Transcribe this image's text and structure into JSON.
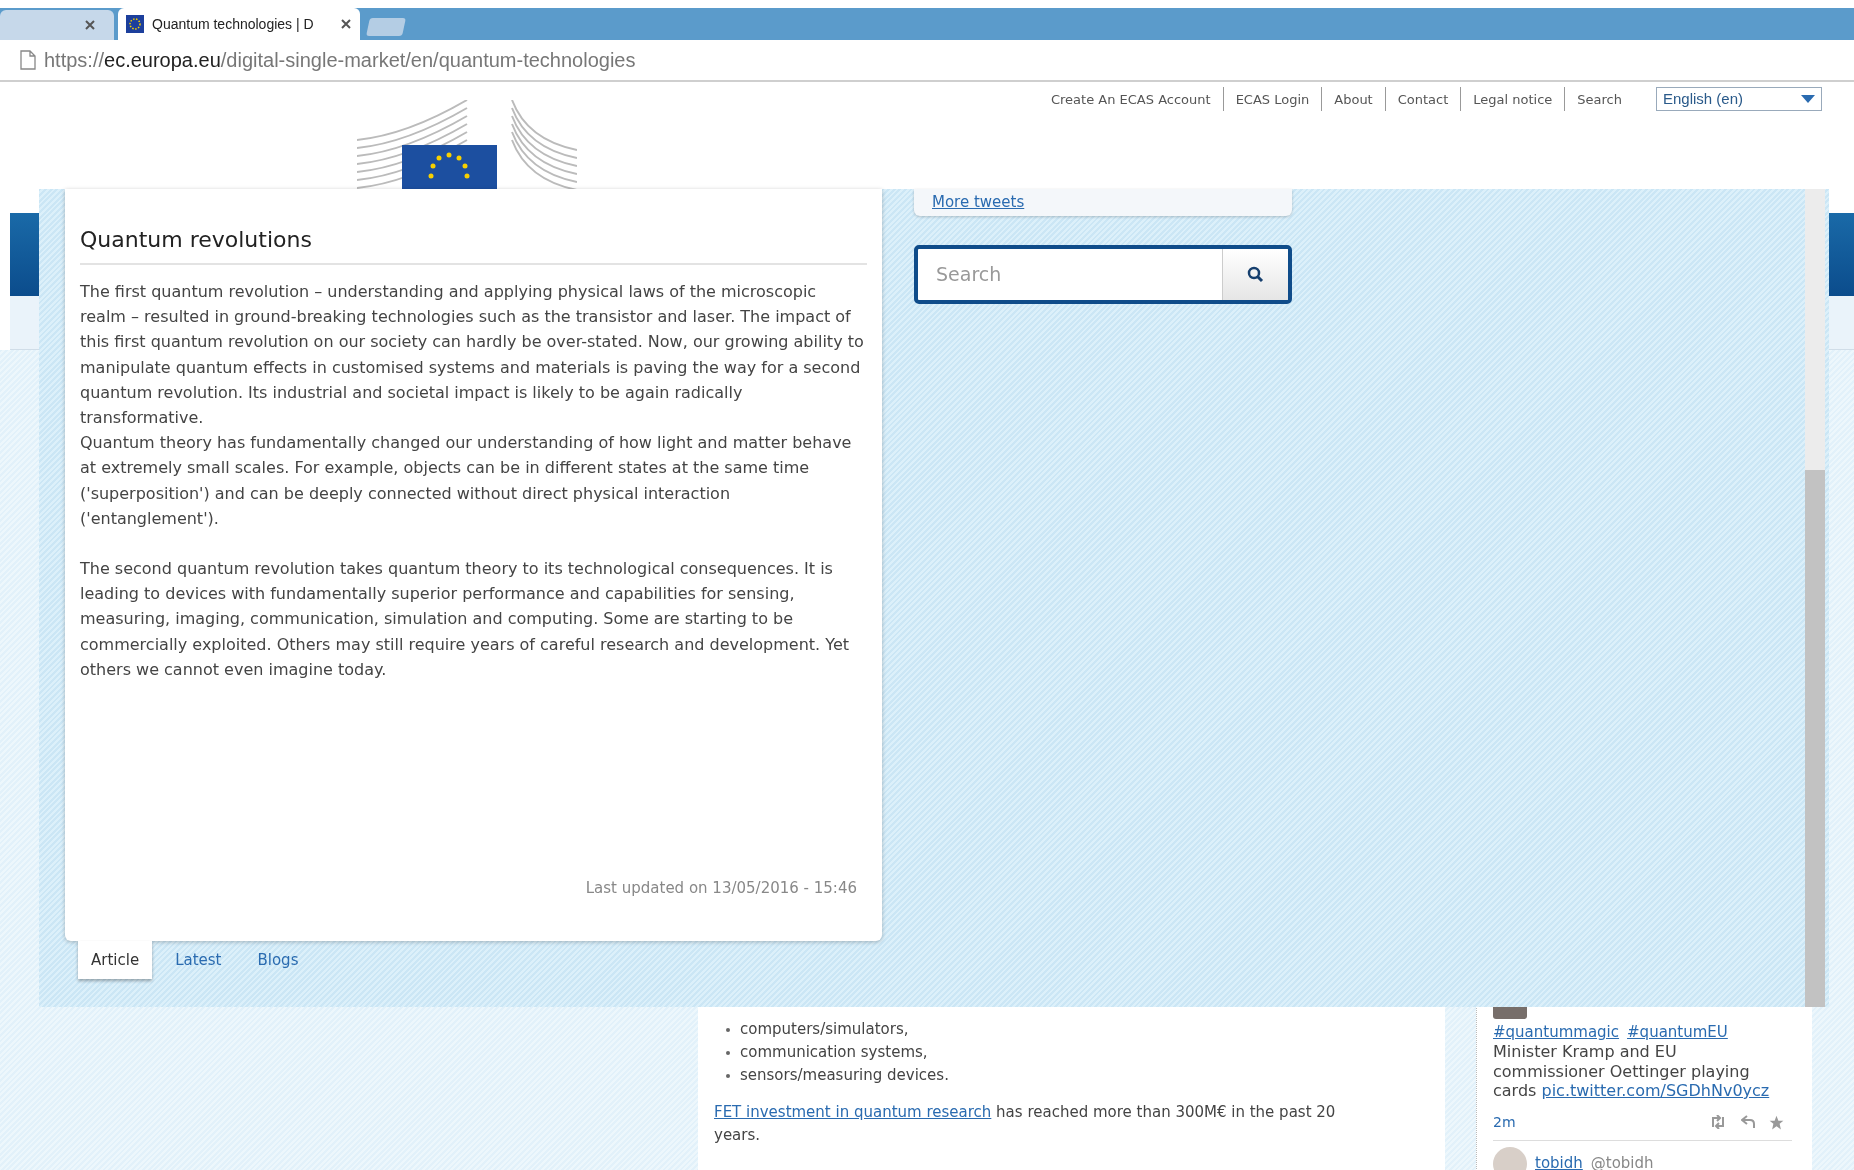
{
  "browser_tabs": [
    {
      "selected": false
    },
    {
      "title": "Quantum technologies | D",
      "selected": true
    }
  ],
  "address": {
    "scheme": "https://",
    "host": "ec.europa.eu",
    "path": "/digital-single-market/en/quantum-technologies"
  },
  "top_links": [
    "Create An ECAS Account",
    "ECAS Login",
    "About",
    "Contact",
    "Legal notice",
    "Search"
  ],
  "language_select": {
    "value": "English (en)"
  },
  "dialog": {
    "article": {
      "title": "Quantum revolutions",
      "blocks": [
        [
          "The first quantum revolution – understanding and applying physical laws of the microscopic realm – resulted in ground-breaking technologies such as the transistor and laser. The impact of this first quantum revolution on our society can hardly be over-stated. Now, our growing ability to manipulate quantum effects in customised systems and materials is paving the way for a second quantum revolution. Its industrial and societal impact is likely to be again radically transformative.",
          "Quantum theory has fundamentally changed our understanding of how light and matter behave at extremely small scales. For example, objects can be in different states at the same time ('superposition') and can be deeply connected without direct physical interaction ('entanglement')."
        ],
        [
          "The second quantum revolution takes quantum theory to its technological consequences. It is leading to devices with fundamentally superior performance and capabilities for sensing, measuring, imaging, communication, simulation and computing. Some are starting to be commercially exploited. Others may still require years of careful research and development. Yet others we cannot even imagine today."
        ]
      ],
      "last_updated": "Last updated on 13/05/2016 - 15:46"
    },
    "tabs": [
      {
        "label": "Article",
        "selected": true
      },
      {
        "label": "Latest",
        "selected": false
      },
      {
        "label": "Blogs",
        "selected": false
      }
    ],
    "tweets_link": "More tweets",
    "search": {
      "placeholder": "Search"
    }
  },
  "content": {
    "list": [
      "computers/simulators,",
      "communication systems,",
      "sensors/measuring devices."
    ],
    "paragraph": {
      "link": "FET investment in quantum research",
      "text": " has reached more than 300M€ in the past 20 years."
    }
  },
  "tweets": [
    {
      "hashtags": [
        "#quantummagic",
        "#quantumEU"
      ],
      "text": "Minister Kramp and EU commissioner Oettinger playing cards ",
      "link": "pic.twitter.com/SGDhNv0ycz",
      "time": "2m"
    },
    {
      "name": "tobidh",
      "handle": "@tobidh"
    }
  ]
}
